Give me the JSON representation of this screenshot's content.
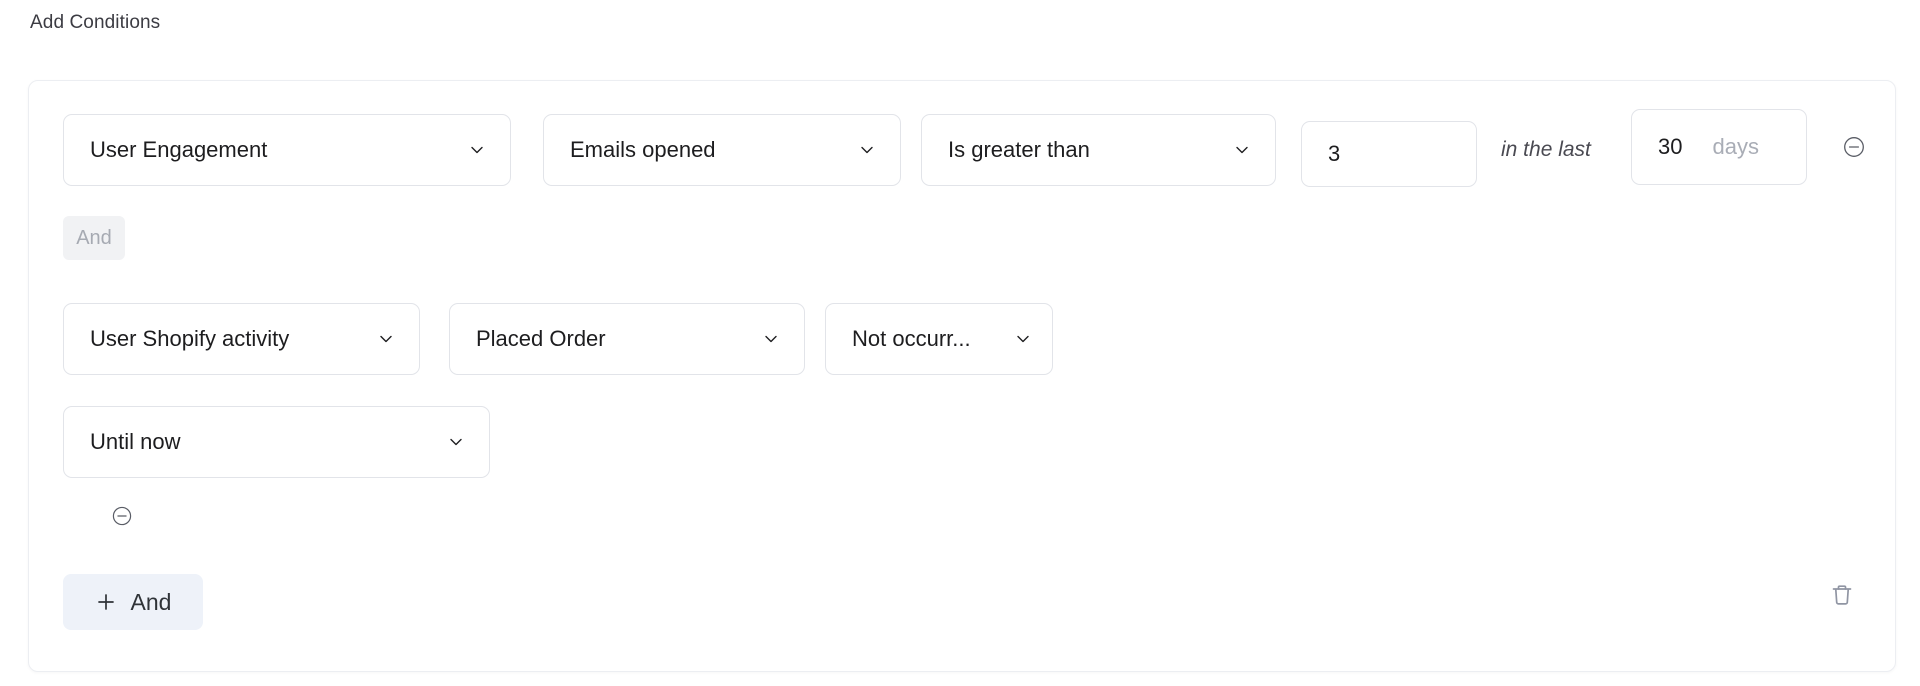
{
  "section": {
    "title": "Add Conditions"
  },
  "conditions": [
    {
      "id": "condition-1",
      "category": "User Engagement",
      "attribute": "Emails opened",
      "operator": "Is greater than",
      "value": "3",
      "timeframe_note": "in the last",
      "timeframe_value": "30",
      "timeframe_unit": "days",
      "remove_icon": "circle-minus-icon"
    },
    {
      "id": "condition-2",
      "category": "User Shopify activity",
      "attribute": "Placed Order",
      "operator": "Not occurr...",
      "timeframe": "Until now",
      "remove_icon": "circle-minus-icon"
    }
  ],
  "connector_chip": {
    "label": "And"
  },
  "add_button": {
    "label": "And",
    "icon": "plus-icon"
  },
  "delete_group": {
    "icon": "trash-icon"
  },
  "icons": {
    "chevron_down": "chevron-down-icon"
  },
  "colors": {
    "card_border": "#eceef2",
    "field_border": "#e2e4e9",
    "text_primary": "#1d1d1f",
    "text_muted": "#a9adb6",
    "chip_bg": "#f1f2f4",
    "add_button_bg": "#eef2f9",
    "trash": "#9095a3"
  }
}
